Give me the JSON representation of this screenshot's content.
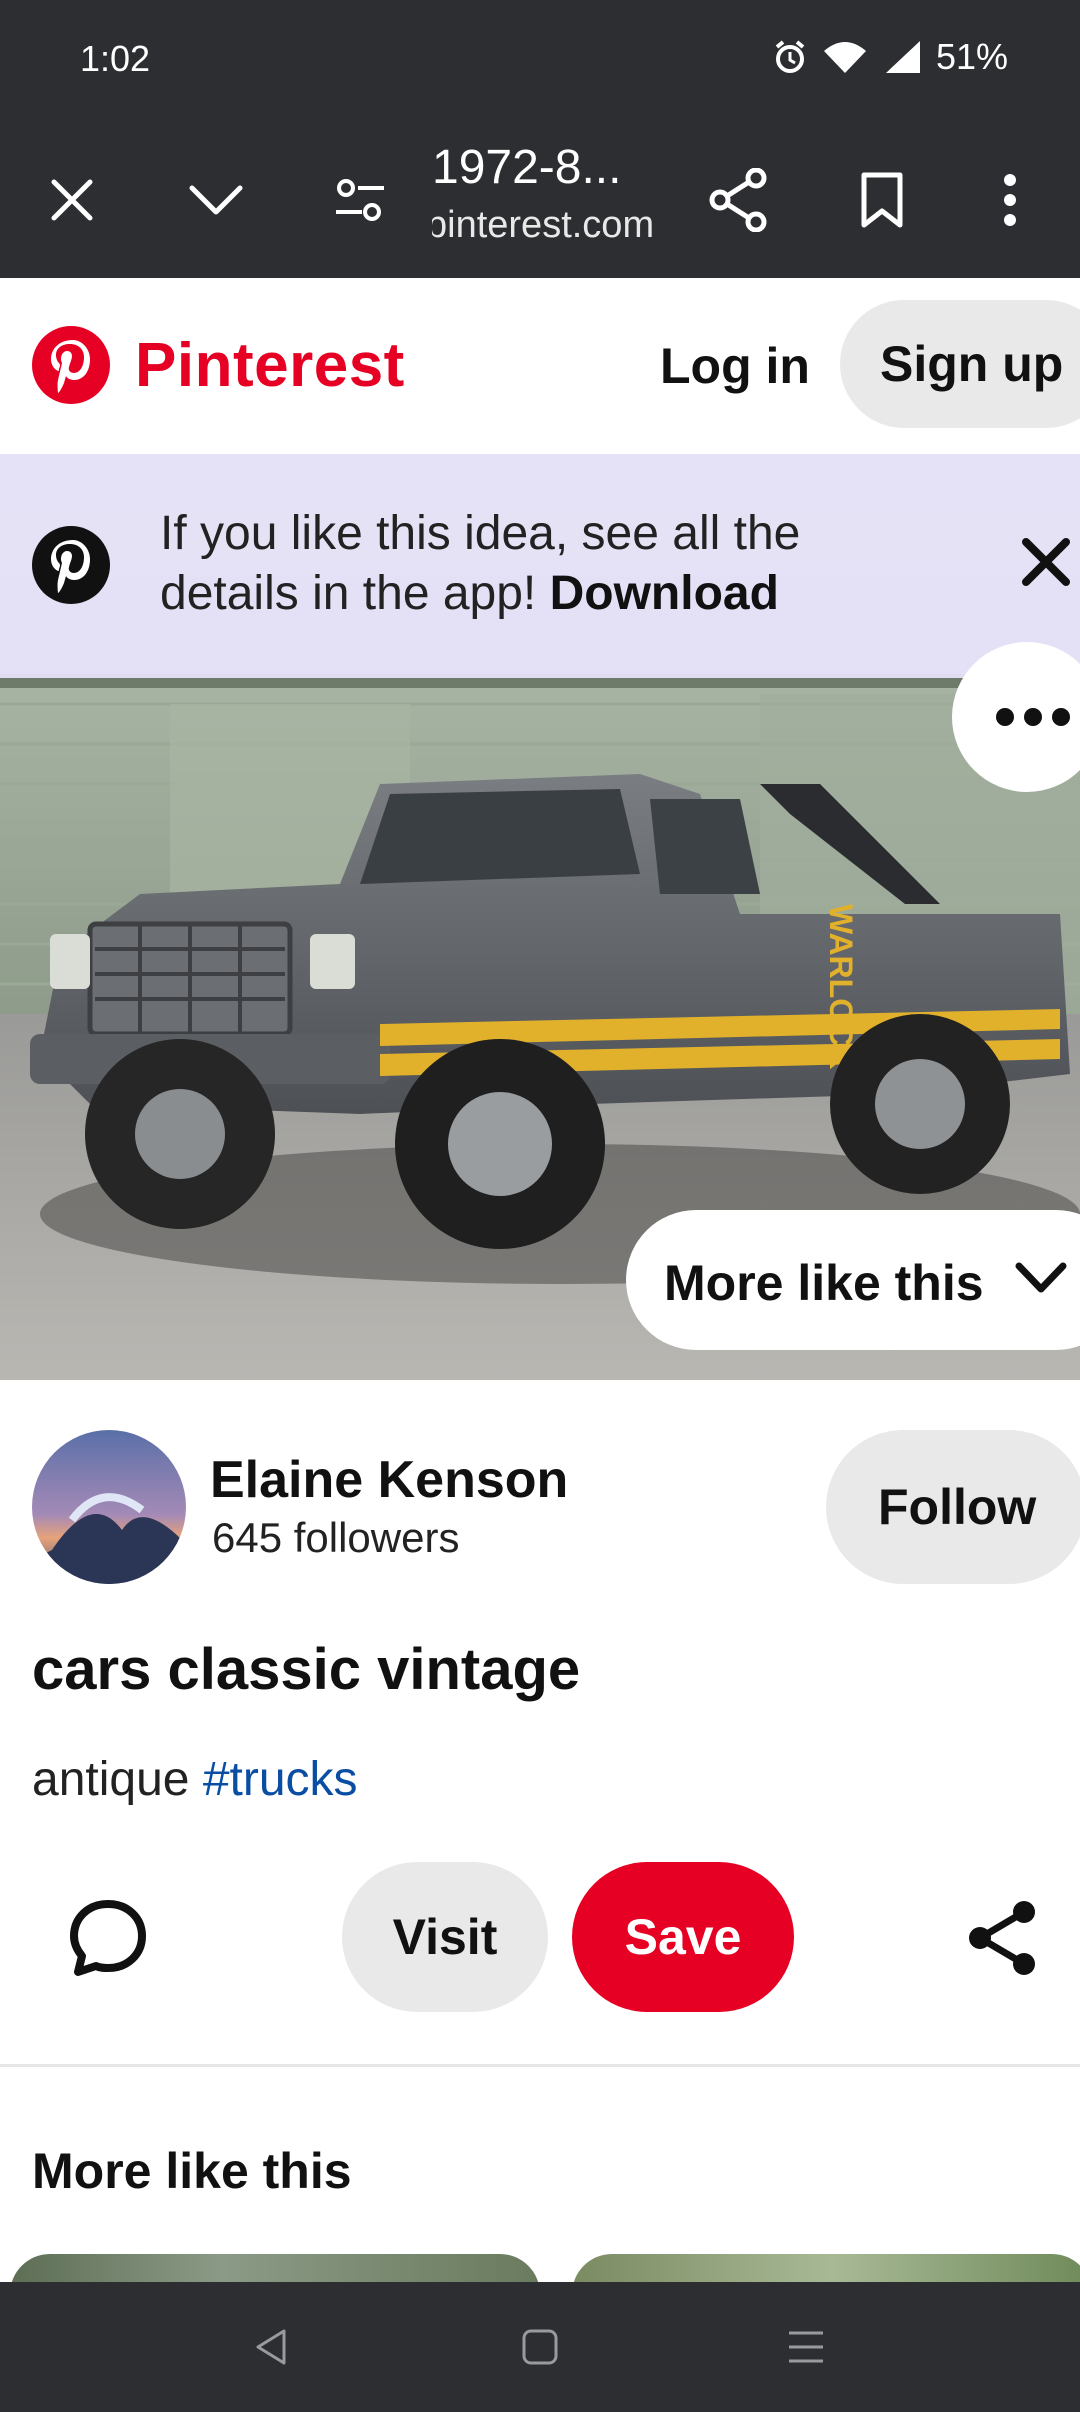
{
  "status_bar": {
    "time": "1:02",
    "battery": "51%"
  },
  "browser": {
    "page_title": "1972-8...",
    "domain": "pinterest.com"
  },
  "header": {
    "brand": "Pinterest",
    "login_label": "Log in",
    "signup_label": "Sign up",
    "brand_color": "#e60023"
  },
  "banner": {
    "text": "If you like this idea, see all the details in the app!",
    "link_label": "Download"
  },
  "image": {
    "truck_decal_text": "WARLOCK",
    "overlay_button_label": "More like this"
  },
  "author": {
    "name": "Elaine Kenson",
    "followers": "645 followers",
    "follow_label": "Follow"
  },
  "pin": {
    "title": "cars classic vintage",
    "description_prefix": "antique",
    "hashtag": "#trucks"
  },
  "actions": {
    "visit_label": "Visit",
    "save_label": "Save"
  },
  "more_section": {
    "title": "More like this"
  }
}
